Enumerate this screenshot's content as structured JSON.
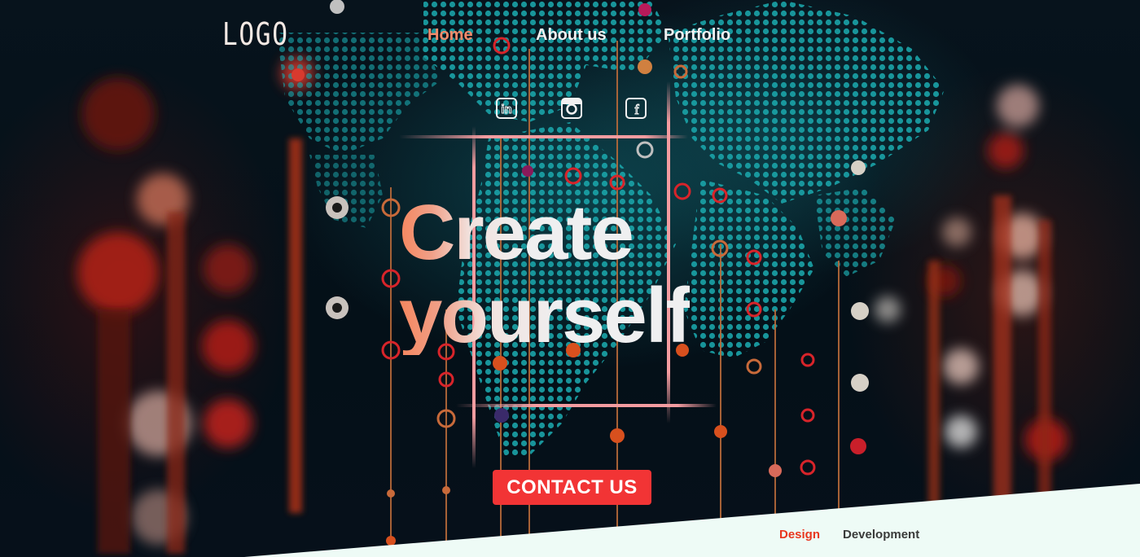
{
  "header": {
    "logo_text": "LOGO",
    "nav": [
      {
        "label": "Home",
        "active": true
      },
      {
        "label": "About us",
        "active": false
      },
      {
        "label": "Portfolio",
        "active": false
      }
    ]
  },
  "social": [
    {
      "icon": "linkedin-icon",
      "glyph": "in"
    },
    {
      "icon": "instagram-icon"
    },
    {
      "icon": "facebook-icon",
      "glyph": "f"
    }
  ],
  "hero": {
    "headline_line1": "Create",
    "headline_line2": "yourself",
    "cta_label": "CONTACT US"
  },
  "bottom_tabs": [
    {
      "label": "Design",
      "active": true
    },
    {
      "label": "Development",
      "active": false
    }
  ],
  "colors": {
    "accent": "#f48a6a",
    "cta": "#f23435",
    "teal_map": "#1a9aa0",
    "bottom_band": "#eefbf6",
    "tab_active": "#e8361f",
    "tab_inactive": "#3a3a3a"
  }
}
